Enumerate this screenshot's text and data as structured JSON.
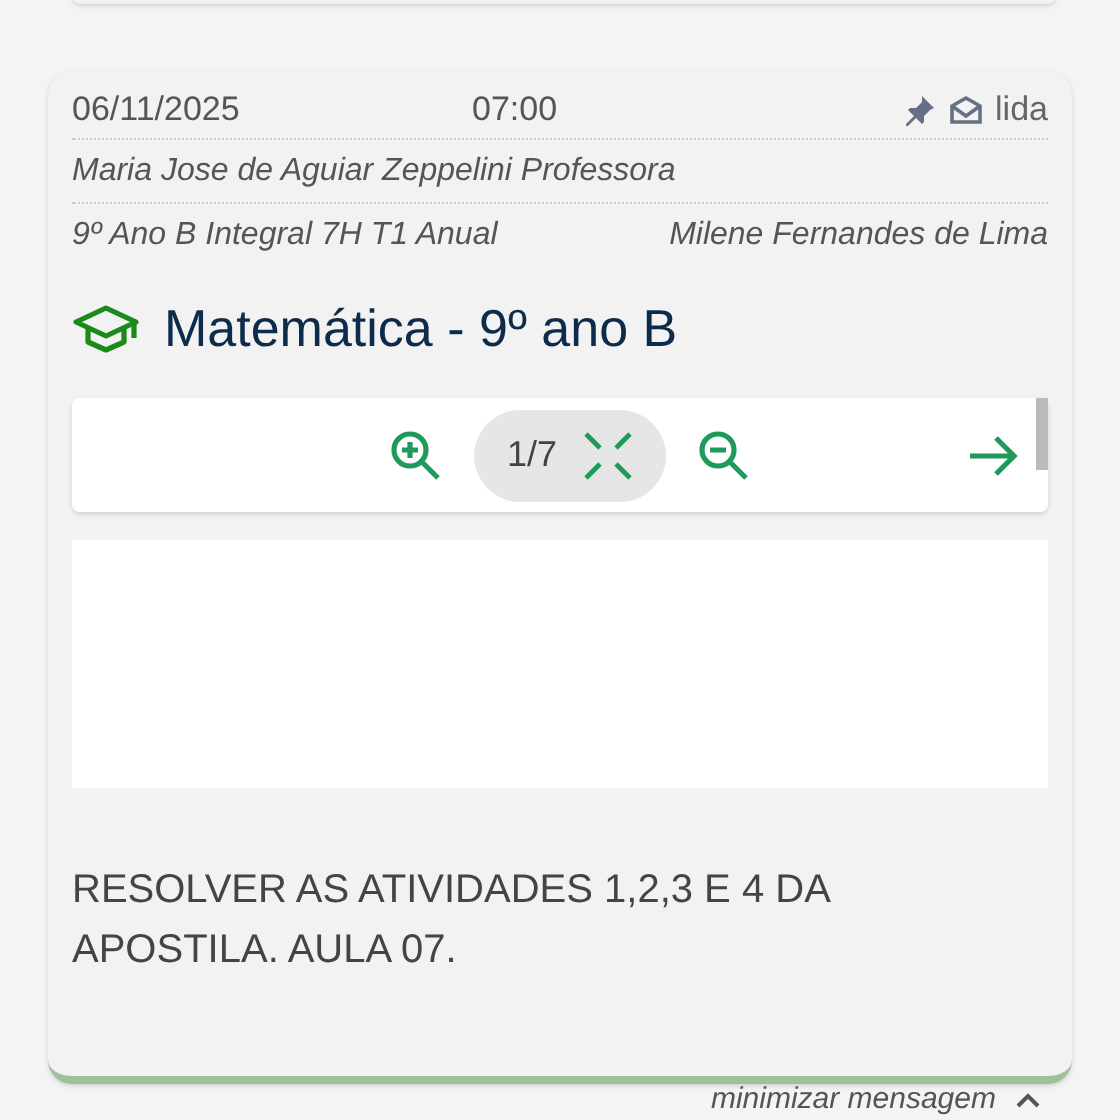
{
  "message": {
    "date": "06/11/2025",
    "time": "07:00",
    "pinned": true,
    "status": "lida",
    "author": "Maria Jose de Aguiar Zeppelini Professora",
    "class_name": "9º Ano B Integral 7H T1 Anual",
    "recipient": "Milene Fernandes de Lima",
    "title": "Matemática - 9º ano B",
    "viewer": {
      "page": "1/7"
    },
    "body": "RESOLVER AS ATIVIDADES 1,2,3 E 4 DA APOSTILA. AULA 07."
  },
  "footer": {
    "link": "minimizar mensagem"
  }
}
